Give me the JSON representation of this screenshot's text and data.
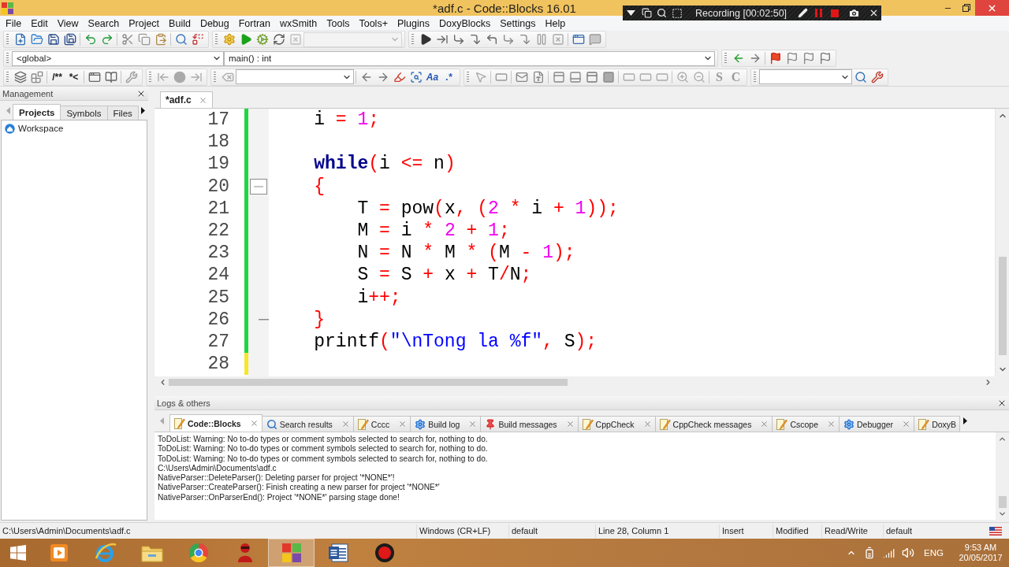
{
  "window": {
    "title": "*adf.c - Code::Blocks 16.01"
  },
  "recorder": {
    "status": "Recording [00:02:50]"
  },
  "menu": [
    "File",
    "Edit",
    "View",
    "Search",
    "Project",
    "Build",
    "Debug",
    "Fortran",
    "wxSmith",
    "Tools",
    "Tools+",
    "Plugins",
    "DoxyBlocks",
    "Settings",
    "Help"
  ],
  "toolbar": {
    "scope": "<global>",
    "function": "main() : int",
    "glyph_buttons": [
      "/**",
      "*<",
      "Aa",
      ".*",
      "S",
      "C"
    ]
  },
  "management": {
    "title": "Management",
    "tabs": [
      {
        "label": "Projects",
        "selected": true
      },
      {
        "label": "Symbols",
        "selected": false
      },
      {
        "label": "Files",
        "selected": false
      }
    ],
    "tree": [
      {
        "label": "Workspace"
      }
    ]
  },
  "editor": {
    "tabs": [
      {
        "label": "*adf.c",
        "selected": true
      }
    ],
    "lines": [
      {
        "number": "17",
        "saved": true,
        "fold_start": false,
        "fold_end": false,
        "tokens": [
          {
            "text": "    i ",
            "kind": "plain"
          },
          {
            "text": "= ",
            "kind": "operator"
          },
          {
            "text": "1",
            "kind": "number"
          },
          {
            "text": ";",
            "kind": "operator"
          }
        ]
      },
      {
        "number": "18",
        "saved": true,
        "fold_start": false,
        "fold_end": false
      },
      {
        "number": "19",
        "saved": true,
        "fold_start": false,
        "fold_end": false,
        "tokens": [
          {
            "text": "    while",
            "kind": "keyword"
          },
          {
            "text": "(",
            "kind": "operator"
          },
          {
            "text": "i ",
            "kind": "plain"
          },
          {
            "text": "<=",
            "kind": "operator"
          },
          {
            "text": " n",
            "kind": "plain"
          },
          {
            "text": ")",
            "kind": "operator"
          }
        ]
      },
      {
        "number": "20",
        "saved": true,
        "fold_start": true,
        "fold_end": false,
        "tokens": [
          {
            "text": "    {",
            "kind": "operator"
          }
        ]
      },
      {
        "number": "21",
        "saved": true,
        "fold_start": false,
        "fold_end": false,
        "tokens": [
          {
            "text": "        T ",
            "kind": "plain"
          },
          {
            "text": "=",
            "kind": "operator"
          },
          {
            "text": " pow",
            "kind": "plain"
          },
          {
            "text": "(",
            "kind": "operator"
          },
          {
            "text": "x",
            "kind": "plain"
          },
          {
            "text": ", (",
            "kind": "operator"
          },
          {
            "text": "2",
            "kind": "number"
          },
          {
            "text": " *",
            "kind": "operator"
          },
          {
            "text": " i ",
            "kind": "plain"
          },
          {
            "text": "+ ",
            "kind": "operator"
          },
          {
            "text": "1",
            "kind": "number"
          },
          {
            "text": "));",
            "kind": "operator"
          }
        ]
      },
      {
        "number": "22",
        "saved": true,
        "fold_start": false,
        "fold_end": false,
        "tokens": [
          {
            "text": "        M ",
            "kind": "plain"
          },
          {
            "text": "=",
            "kind": "operator"
          },
          {
            "text": " i ",
            "kind": "plain"
          },
          {
            "text": "* ",
            "kind": "operator"
          },
          {
            "text": "2",
            "kind": "number"
          },
          {
            "text": " + ",
            "kind": "operator"
          },
          {
            "text": "1",
            "kind": "number"
          },
          {
            "text": ";",
            "kind": "operator"
          }
        ]
      },
      {
        "number": "23",
        "saved": true,
        "fold_start": false,
        "fold_end": false,
        "tokens": [
          {
            "text": "        N ",
            "kind": "plain"
          },
          {
            "text": "=",
            "kind": "operator"
          },
          {
            "text": " N ",
            "kind": "plain"
          },
          {
            "text": "*",
            "kind": "operator"
          },
          {
            "text": " M ",
            "kind": "plain"
          },
          {
            "text": "* (",
            "kind": "operator"
          },
          {
            "text": "M ",
            "kind": "plain"
          },
          {
            "text": "- ",
            "kind": "operator"
          },
          {
            "text": "1",
            "kind": "number"
          },
          {
            "text": ");",
            "kind": "operator"
          }
        ]
      },
      {
        "number": "24",
        "saved": true,
        "fold_start": false,
        "fold_end": false,
        "tokens": [
          {
            "text": "        S ",
            "kind": "plain"
          },
          {
            "text": "=",
            "kind": "operator"
          },
          {
            "text": " S ",
            "kind": "plain"
          },
          {
            "text": "+",
            "kind": "operator"
          },
          {
            "text": " x ",
            "kind": "plain"
          },
          {
            "text": "+",
            "kind": "operator"
          },
          {
            "text": " T",
            "kind": "plain"
          },
          {
            "text": "/",
            "kind": "operator"
          },
          {
            "text": "N",
            "kind": "plain"
          },
          {
            "text": ";",
            "kind": "operator"
          }
        ]
      },
      {
        "number": "25",
        "saved": true,
        "fold_start": false,
        "fold_end": false,
        "tokens": [
          {
            "text": "        i",
            "kind": "plain"
          },
          {
            "text": "++;",
            "kind": "operator"
          }
        ]
      },
      {
        "number": "26",
        "saved": true,
        "fold_start": false,
        "fold_end": true,
        "tokens": [
          {
            "text": "    }",
            "kind": "operator"
          }
        ]
      },
      {
        "number": "27",
        "saved": true,
        "fold_start": false,
        "fold_end": false,
        "tokens": [
          {
            "text": "    printf",
            "kind": "plain"
          },
          {
            "text": "(",
            "kind": "operator"
          },
          {
            "text": "\"\\nTong la %f\"",
            "kind": "string"
          },
          {
            "text": ",",
            "kind": "operator"
          },
          {
            "text": " S",
            "kind": "plain"
          },
          {
            "text": ");",
            "kind": "operator"
          }
        ]
      },
      {
        "number": "28",
        "saved": false,
        "fold_start": false,
        "fold_end": false
      }
    ]
  },
  "logs": {
    "title": "Logs & others",
    "tabs": [
      {
        "label": "Code::Blocks",
        "kind": "log",
        "selected": true,
        "clipped": false
      },
      {
        "label": "Search results",
        "kind": "search",
        "selected": false,
        "clipped": false
      },
      {
        "label": "Cccc",
        "kind": "log",
        "selected": false,
        "clipped": false
      },
      {
        "label": "Build log",
        "kind": "process",
        "selected": false,
        "clipped": false
      },
      {
        "label": "Build messages",
        "kind": "messages",
        "selected": false,
        "clipped": false
      },
      {
        "label": "CppCheck",
        "kind": "log",
        "selected": false,
        "clipped": false
      },
      {
        "label": "CppCheck messages",
        "kind": "log",
        "selected": false,
        "clipped": false
      },
      {
        "label": "Cscope",
        "kind": "log",
        "selected": false,
        "clipped": false
      },
      {
        "label": "Debugger",
        "kind": "process",
        "selected": false,
        "clipped": false
      },
      {
        "label": "DoxyB",
        "kind": "log",
        "selected": false,
        "clipped": true
      }
    ],
    "lines": [
      "ToDoList: Warning: No to-do types or comment symbols selected to search for, nothing to do.",
      "ToDoList: Warning: No to-do types or comment symbols selected to search for, nothing to do.",
      "ToDoList: Warning: No to-do types or comment symbols selected to search for, nothing to do.",
      "C:\\Users\\Admin\\Documents\\adf.c",
      "NativeParser::DeleteParser(): Deleting parser for project '*NONE*'!",
      "NativeParser::CreateParser(): Finish creating a new parser for project '*NONE*'",
      "NativeParser::OnParserEnd(): Project '*NONE*' parsing stage done!"
    ]
  },
  "status_bar": {
    "fields": [
      "C:\\Users\\Admin\\Documents\\adf.c",
      "Windows (CR+LF)",
      "default",
      "Line 28, Column 1",
      "Insert",
      "Modified",
      "Read/Write",
      "default"
    ]
  },
  "taskbar": {
    "apps": [
      {
        "selected": false
      },
      {
        "selected": false
      },
      {
        "selected": false
      },
      {
        "selected": false
      },
      {
        "selected": false
      },
      {
        "selected": true
      },
      {
        "selected": false
      },
      {
        "selected": false
      }
    ],
    "language": "ENG",
    "time": "9:53 AM",
    "date": "20/05/2017"
  }
}
